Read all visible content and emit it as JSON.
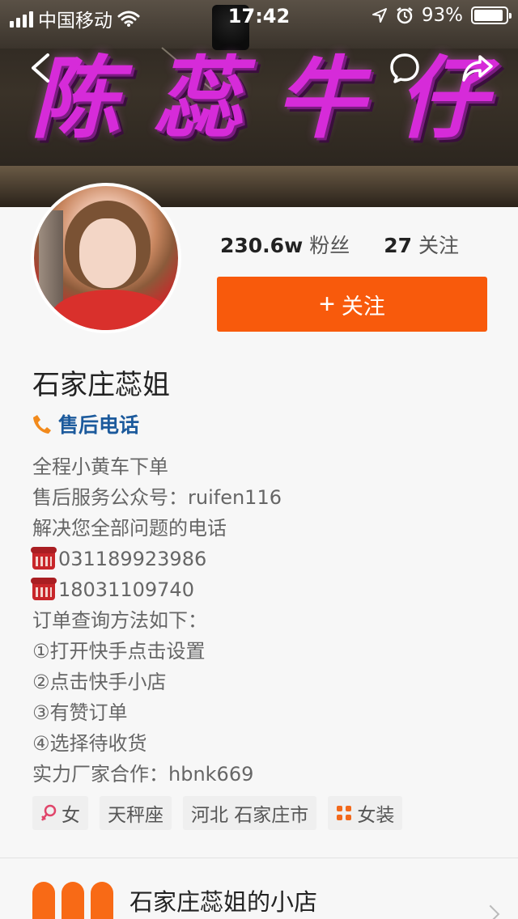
{
  "status_bar": {
    "carrier": "中国移动",
    "time": "17:42",
    "battery": "93%",
    "battery_level": 0.93
  },
  "banner": {
    "sign_text": [
      "陈",
      "蕊",
      "牛",
      "仔"
    ]
  },
  "profile": {
    "fans_count": "230.6w",
    "fans_label": "粉丝",
    "following_count": "27",
    "following_label": "关注",
    "follow_button": "关注",
    "name": "石家庄蕊姐",
    "aftersale_label": "售后电话",
    "bio": [
      "全程小黄车下单",
      "售后服务公众号：ruifen116",
      "解决您全部问题的电话",
      "031189923986",
      "18031109740",
      "订单查询方法如下：",
      "①打开快手点击设置",
      "②点击快手小店",
      "③有赞订单",
      "④选择待收货",
      "实力厂家合作：hbnk669"
    ],
    "tags": [
      {
        "icon": "female-icon",
        "label": "女"
      },
      {
        "icon": "",
        "label": "天秤座"
      },
      {
        "icon": "",
        "label": "河北 石家庄市"
      },
      {
        "icon": "grid-icon",
        "label": "女装"
      }
    ]
  },
  "shop": {
    "name": "石家庄蕊姐的小店"
  },
  "colors": {
    "accent": "#f85a0c",
    "link": "#1c5a9c",
    "sign": "#d62bd9"
  }
}
